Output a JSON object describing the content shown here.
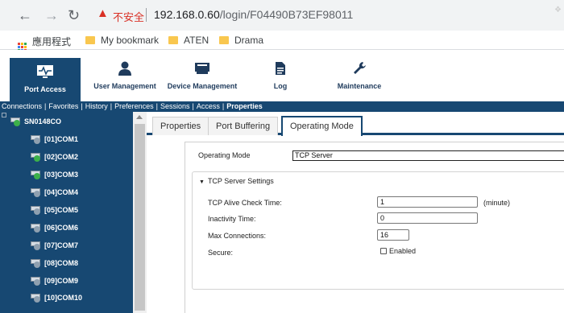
{
  "browser": {
    "insecure_label": "不安全",
    "url_host": "192.168.0.60",
    "url_path": "/login/F04490B73EF98011"
  },
  "bookmarks": [
    {
      "label": "應用程式",
      "icon": "apps-grid-icon"
    },
    {
      "label": "My bookmark",
      "icon": "folder-icon"
    },
    {
      "label": "ATEN",
      "icon": "folder-icon"
    },
    {
      "label": "Drama",
      "icon": "folder-icon"
    }
  ],
  "main_menu": [
    {
      "label": "Port Access",
      "icon": "heartbeat-monitor-icon",
      "active": true
    },
    {
      "label": "User Management",
      "icon": "user-icon"
    },
    {
      "label": "Device Management",
      "icon": "device-icon"
    },
    {
      "label": "Log",
      "icon": "document-icon"
    },
    {
      "label": "Maintenance",
      "icon": "wrench-icon"
    }
  ],
  "subnav": [
    "Connections",
    "Favorites",
    "History",
    "Preferences",
    "Sessions",
    "Access",
    "Properties"
  ],
  "sidebar": {
    "root": "SN0148CO",
    "ports": [
      "[01]COM1",
      "[02]COM2",
      "[03]COM3",
      "[04]COM4",
      "[05]COM5",
      "[06]COM6",
      "[07]COM7",
      "[08]COM8",
      "[09]COM9",
      "[10]COM10"
    ]
  },
  "tabs": [
    "Properties",
    "Port Buffering",
    "Operating Mode"
  ],
  "operating_mode": {
    "label": "Operating Mode",
    "value": "TCP Server"
  },
  "tcp_settings": {
    "title": "TCP Server Settings",
    "alive_label": "TCP Alive Check Time:",
    "alive_value": "1",
    "alive_unit": "(minute)",
    "inactivity_label": "Inactivity Time:",
    "inactivity_value": "0",
    "maxconn_label": "Max Connections:",
    "maxconn_value": "16",
    "secure_label": "Secure:",
    "secure_option": "Enabled"
  },
  "colors": {
    "brand_navy": "#174872",
    "status_green": "#3cb04a",
    "warning_red": "#d93025"
  }
}
